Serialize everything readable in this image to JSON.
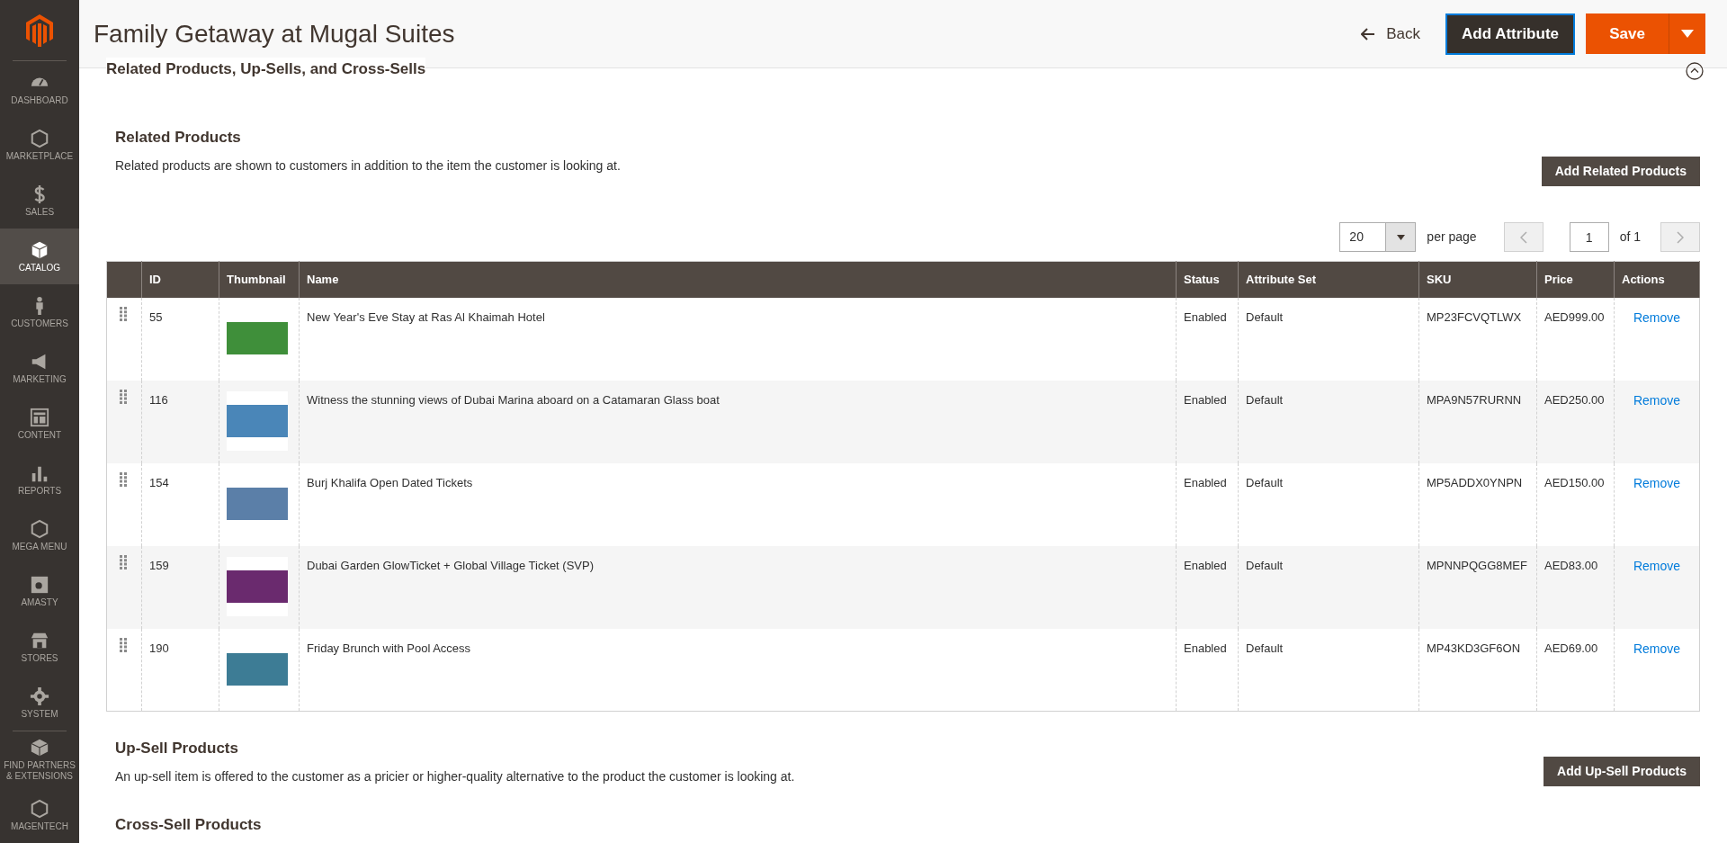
{
  "sidebar": {
    "items": [
      {
        "label": "DASHBOARD",
        "selected": false
      },
      {
        "label": "MARKETPLACE",
        "selected": false
      },
      {
        "label": "SALES",
        "selected": false
      },
      {
        "label": "CATALOG",
        "selected": true
      },
      {
        "label": "CUSTOMERS",
        "selected": false
      },
      {
        "label": "MARKETING",
        "selected": false
      },
      {
        "label": "CONTENT",
        "selected": false
      },
      {
        "label": "REPORTS",
        "selected": false
      },
      {
        "label": "MEGA MENU",
        "selected": false
      },
      {
        "label": "AMASTY",
        "selected": false
      },
      {
        "label": "STORES",
        "selected": false
      },
      {
        "label": "SYSTEM",
        "selected": false
      },
      {
        "label": "FIND PARTNERS & EXTENSIONS",
        "selected": false
      },
      {
        "label": "MAGENTECH",
        "selected": false
      }
    ]
  },
  "header": {
    "title": "Family Getaway at Mugal Suites",
    "back": "Back",
    "add_attribute": "Add Attribute",
    "save": "Save"
  },
  "section": {
    "title": "Related Products, Up-Sells, and Cross-Sells",
    "expanded": true
  },
  "related": {
    "title": "Related Products",
    "description": "Related products are shown to customers in addition to the item the customer is looking at.",
    "button": "Add Related Products",
    "pager": {
      "per_page_value": "20",
      "per_page_label": "per page",
      "page": "1",
      "of_pages": "of 1"
    },
    "columns": [
      "ID",
      "Thumbnail",
      "Name",
      "Status",
      "Attribute Set",
      "SKU",
      "Price",
      "Actions"
    ],
    "rows": [
      {
        "id": "55",
        "name": "New Year's Eve Stay at Ras Al Khaimah Hotel",
        "status": "Enabled",
        "attribute_set": "Default",
        "sku": "MP23FCVQTLWX",
        "price": "AED999.00",
        "action": "Remove"
      },
      {
        "id": "116",
        "name": "Witness the stunning views of Dubai Marina aboard on a Catamaran Glass boat",
        "status": "Enabled",
        "attribute_set": "Default",
        "sku": "MPA9N57RURNN",
        "price": "AED250.00",
        "action": "Remove"
      },
      {
        "id": "154",
        "name": "Burj Khalifa Open Dated Tickets",
        "status": "Enabled",
        "attribute_set": "Default",
        "sku": "MP5ADDX0YNPN",
        "price": "AED150.00",
        "action": "Remove"
      },
      {
        "id": "159",
        "name": "Dubai Garden GlowTicket + Global Village Ticket (SVP)",
        "status": "Enabled",
        "attribute_set": "Default",
        "sku": "MPNNPQGG8MEF",
        "price": "AED83.00",
        "action": "Remove"
      },
      {
        "id": "190",
        "name": "Friday Brunch with Pool Access",
        "status": "Enabled",
        "attribute_set": "Default",
        "sku": "MP43KD3GF6ON",
        "price": "AED69.00",
        "action": "Remove"
      }
    ]
  },
  "upsell": {
    "title": "Up-Sell Products",
    "description": "An up-sell item is offered to the customer as a pricier or higher-quality alternative to the product the customer is looking at.",
    "button": "Add Up-Sell Products"
  },
  "crosssell": {
    "title": "Cross-Sell Products"
  }
}
